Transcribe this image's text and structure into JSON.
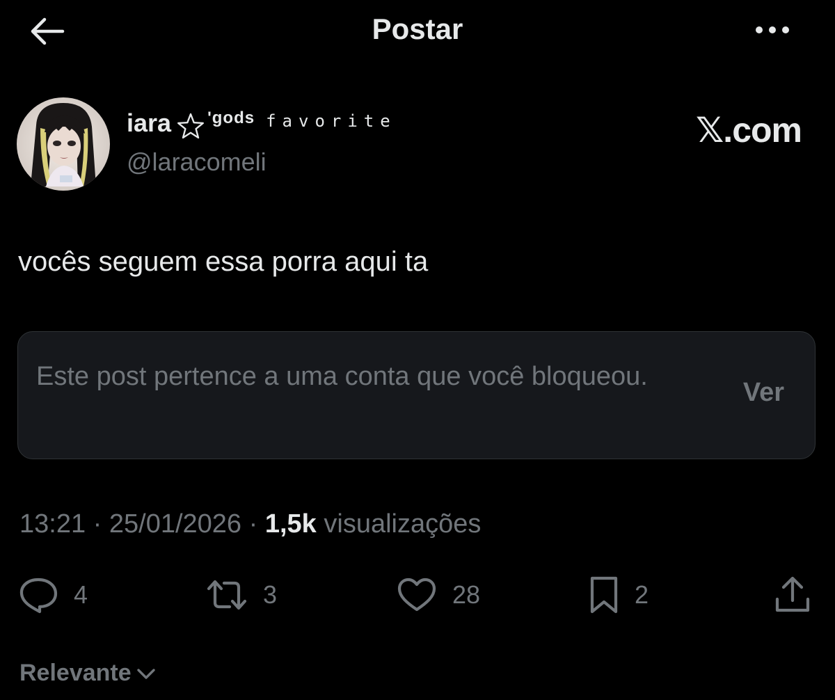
{
  "header": {
    "title": "Postar",
    "back_icon": "arrow-left-icon",
    "more_icon": "more-horizontal-icon"
  },
  "author": {
    "display_name": "iara",
    "name_decoration_a": "'gods",
    "name_decoration_b": "favorite",
    "handle": "@laracomeli"
  },
  "watermark": "𝕏.com",
  "post": {
    "text": "vocês seguem essa porra aqui ta"
  },
  "blocked_notice": {
    "text": "Este post pertence a uma conta que você bloqueou.",
    "action_label": "Ver"
  },
  "meta": {
    "time": "13:21",
    "separator": "·",
    "date": "25/01/2026",
    "views_count": "1,5k",
    "views_label": "visualizações"
  },
  "actions": {
    "replies": "4",
    "reposts": "3",
    "likes": "28",
    "bookmarks": "2"
  },
  "sort": {
    "label": "Relevante"
  },
  "colors": {
    "background": "#000000",
    "primary_text": "#e7e9ea",
    "secondary_text": "#71767b",
    "card_background": "#16181c",
    "card_border": "#2f3336"
  }
}
